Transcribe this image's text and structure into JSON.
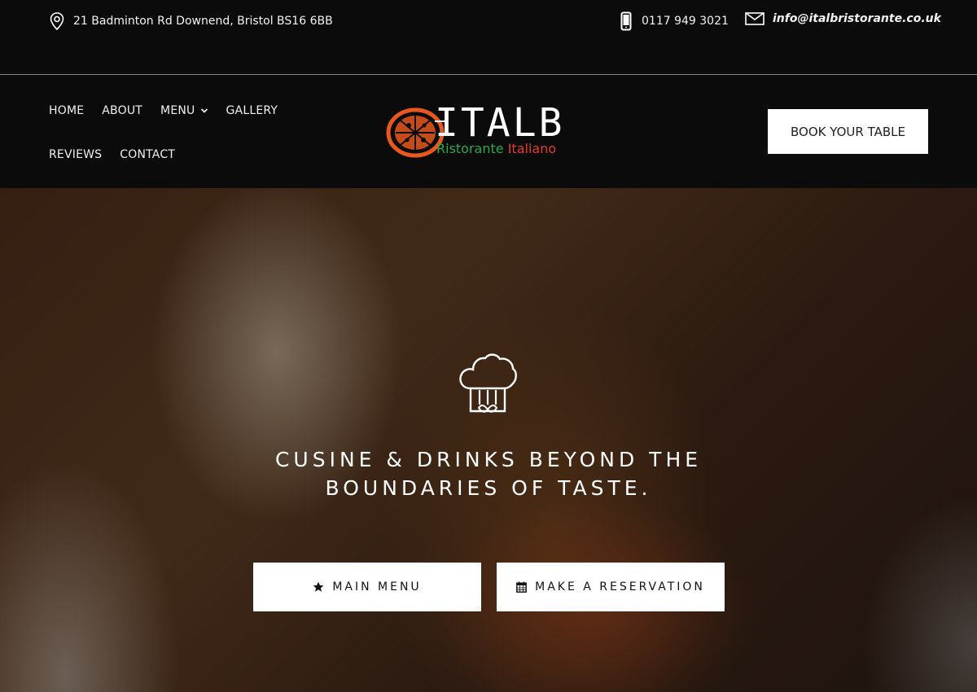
{
  "topbar": {
    "address": "21 Badminton Rd Downend, Bristol BS16 6BB",
    "phone": "0117 949 3021",
    "email": "info@italbristorante.co.uk"
  },
  "nav": {
    "items": [
      {
        "label": "HOME"
      },
      {
        "label": "ABOUT"
      },
      {
        "label": "MENU",
        "has_dropdown": true
      },
      {
        "label": "GALLERY"
      },
      {
        "label": "REVIEWS"
      },
      {
        "label": "CONTACT"
      }
    ]
  },
  "logo": {
    "main": "ITALB",
    "sub_green": "Ristorante",
    "sub_red": "Italiano"
  },
  "header": {
    "book_label": "BOOK YOUR TABLE"
  },
  "hero": {
    "title_line1": "CUSINE & DRINKS BEYOND THE",
    "title_line2": "BOUNDARIES OF TASTE.",
    "main_menu_label": "MAIN MENU",
    "reservation_label": "MAKE A RESERVATION",
    "icon": "chef-hat-icon"
  },
  "colors": {
    "background": "#0b0b0b",
    "button_bg": "#ffffff",
    "logo_orange": "#e8571f",
    "logo_green": "#2aa84a",
    "logo_red": "#e23c2c"
  }
}
